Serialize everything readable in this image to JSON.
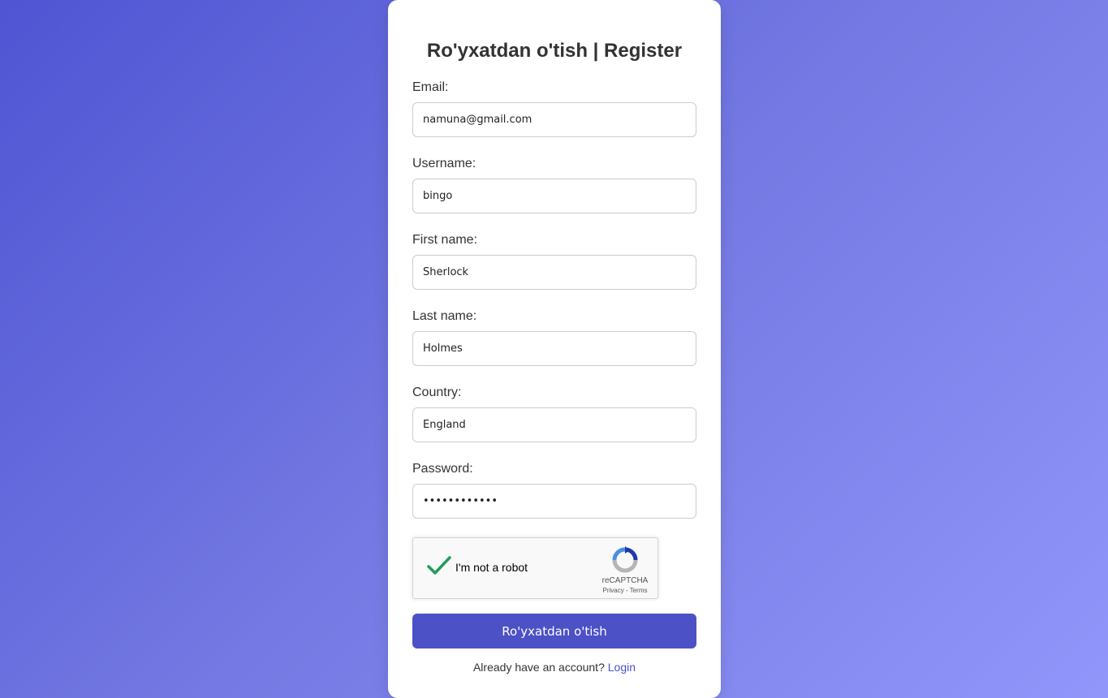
{
  "form": {
    "title": "Ro'yxatdan o'tish | Register",
    "fields": [
      {
        "label": "Email:",
        "value": "namuna@gmail.com",
        "type": "text"
      },
      {
        "label": "Username:",
        "value": "bingo",
        "type": "text"
      },
      {
        "label": "First name:",
        "value": "Sherlock",
        "type": "text"
      },
      {
        "label": "Last name:",
        "value": "Holmes",
        "type": "text"
      },
      {
        "label": "Country:",
        "value": "England",
        "type": "text"
      },
      {
        "label": "Password:",
        "value": "••••••••••••",
        "type": "password"
      }
    ],
    "submit_label": "Ro'yxatdan o'tish",
    "footer_text": "Already have an account?",
    "login_link": "Login"
  },
  "recaptcha": {
    "checked": true,
    "label": "I'm not a robot",
    "brand": "reCAPTCHA",
    "privacy": "Privacy",
    "separator": " - ",
    "terms": "Terms"
  },
  "colors": {
    "primary": "#4c51c6",
    "check": "#1e9e5a",
    "background_start": "#4f55d3",
    "background_end": "#9196fb"
  }
}
